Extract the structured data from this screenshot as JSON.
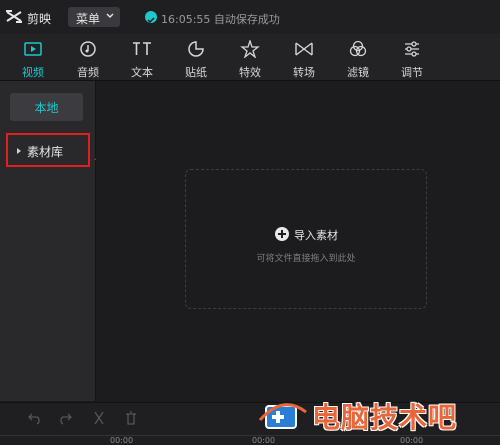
{
  "app": {
    "name": "剪映",
    "menu_label": "菜单",
    "save_status": "16:05:55 自动保存成功"
  },
  "toolbar": {
    "tabs": [
      {
        "label": "视频",
        "icon": "video-icon",
        "active": true
      },
      {
        "label": "音频",
        "icon": "audio-icon",
        "active": false
      },
      {
        "label": "文本",
        "icon": "text-icon",
        "active": false
      },
      {
        "label": "贴纸",
        "icon": "sticker-icon",
        "active": false
      },
      {
        "label": "特效",
        "icon": "effects-icon",
        "active": false
      },
      {
        "label": "转场",
        "icon": "transition-icon",
        "active": false
      },
      {
        "label": "滤镜",
        "icon": "filter-icon",
        "active": false
      },
      {
        "label": "调节",
        "icon": "adjust-icon",
        "active": false
      }
    ]
  },
  "sidebar": {
    "local_label": "本地",
    "library_label": "素材库"
  },
  "main": {
    "import_label": "导入素材",
    "hint": "可将文件直接拖入到此处"
  },
  "timeline": {
    "ticks": [
      "00:00",
      "00:00",
      "00:00"
    ]
  },
  "watermark": {
    "text": "电脑技术吧"
  },
  "colors": {
    "accent": "#1ec8cc",
    "highlight_red": "#e02020",
    "watermark": "#e8663a"
  }
}
